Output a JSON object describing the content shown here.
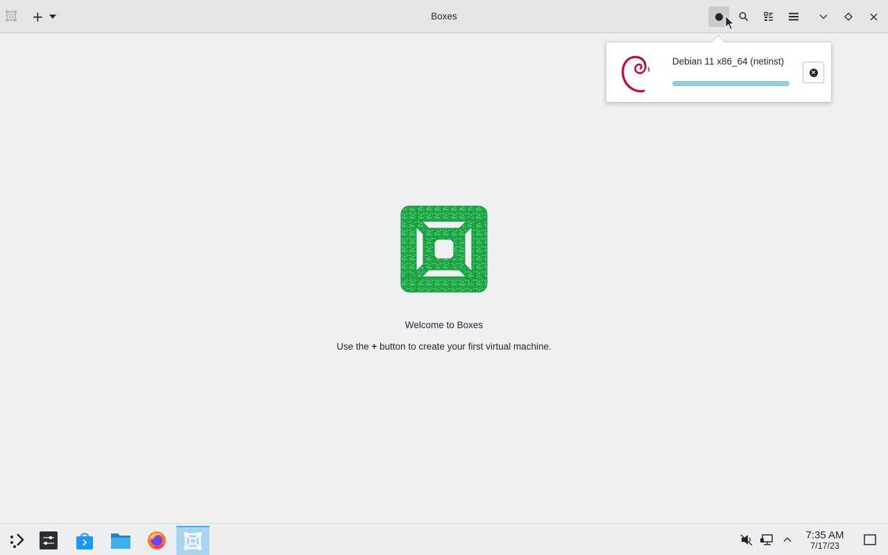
{
  "window": {
    "title": "Boxes",
    "app_icon": "boxes-icon",
    "toolbar": {
      "new_button_icon": "plus-icon",
      "new_dropdown_icon": "caret-down-icon",
      "downloads_icon": "downloads-indicator-icon",
      "search_icon": "search-icon",
      "view_toggle_icon": "list-view-icon",
      "menu_icon": "hamburger-menu-icon",
      "minimize_icon": "chevron-down-icon",
      "maximize_icon": "diamond-icon",
      "close_icon": "close-icon"
    }
  },
  "downloads_popover": {
    "items": [
      {
        "name": "Debian 11 x86_64 (netinst)",
        "icon": "debian-logo-icon",
        "progress": 1.0,
        "cancel_icon": "cancel-icon"
      }
    ]
  },
  "welcome": {
    "logo": "boxes-logo",
    "title": "Welcome to Boxes",
    "text_before": "Use the",
    "text_plus": "+",
    "text_after": "button to create your first virtual machine."
  },
  "taskbar": {
    "launcher_icon": "application-launcher-icon",
    "items": [
      {
        "icon": "system-settings-icon",
        "active": false
      },
      {
        "icon": "discover-store-icon",
        "active": false
      },
      {
        "icon": "file-manager-icon",
        "active": false
      },
      {
        "icon": "firefox-icon",
        "active": false
      },
      {
        "icon": "boxes-icon",
        "active": true
      }
    ],
    "tray": {
      "volume_icon": "volume-muted-icon",
      "network_icon": "network-wired-icon",
      "expand_icon": "chevron-up-icon",
      "show_desktop_icon": "show-desktop-icon"
    },
    "clock": {
      "time": "7:35 AM",
      "date": "7/17/23"
    }
  },
  "colors": {
    "accent": "#3daee9",
    "progress_fill": "#8dd0ea",
    "logo_green": "#1ea847",
    "debian_red": "#c70036"
  }
}
